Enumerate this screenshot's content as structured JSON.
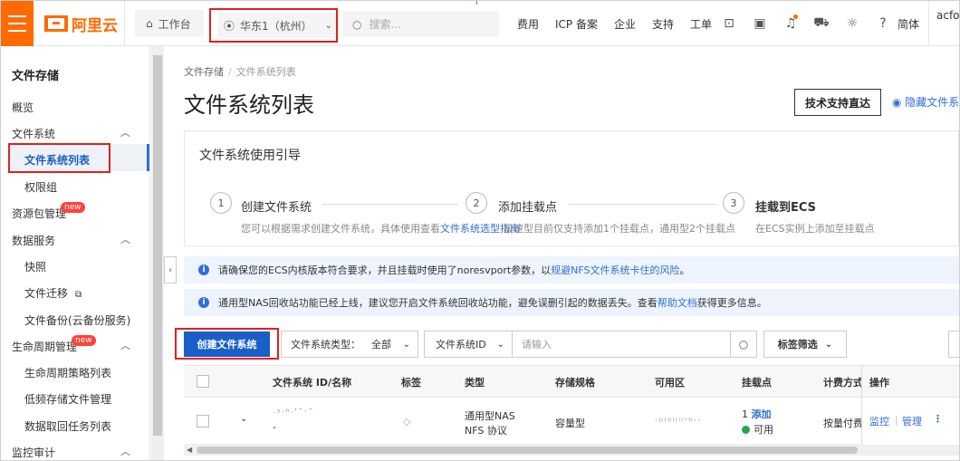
{
  "topbar": {
    "logo_text": "阿里云",
    "workbench_label": "工作台",
    "region_label": "华东1（杭州）",
    "search_placeholder": "搜索...",
    "nav": [
      "费用",
      "ICP 备案",
      "企业",
      "支持",
      "工单"
    ],
    "lang_label": "简体",
    "account_label": "acfor"
  },
  "sidebar": {
    "title": "文件存储",
    "items": {
      "overview": "概览",
      "fs_group": "文件系统",
      "fs_list": "文件系统列表",
      "perm_group": "权限组",
      "pkg_mgmt": "资源包管理",
      "data_service": "数据服务",
      "snapshot": "快照",
      "migration": "文件迁移",
      "backup": "文件备份(云备份服务)",
      "lifecycle": "生命周期管理",
      "lc_policy": "生命周期策略列表",
      "lowfreq": "低频存储文件管理",
      "retrieve": "数据取回任务列表",
      "audit": "监控审计"
    },
    "new_badge": "new"
  },
  "breadcrumb": {
    "root": "文件存储",
    "sep": "/",
    "current": "文件系统列表"
  },
  "page": {
    "title": "文件系统列表",
    "support_button": "技术支持直达",
    "hide_link": "隐藏文件系"
  },
  "guide": {
    "title": "文件系统使用引导",
    "steps": [
      {
        "num": "1",
        "title": "创建文件系统",
        "desc_before": "您可以根据需求创建文件系统，具体使用查看",
        "desc_link": "文件系统选型指南"
      },
      {
        "num": "2",
        "title": "添加挂载点",
        "desc": "极速型目前仅支持添加1个挂载点，通用型2个挂载点"
      },
      {
        "num": "3",
        "title": "挂载到ECS",
        "desc": "在ECS实例上添加至挂载点"
      }
    ]
  },
  "notices": [
    {
      "before": "请确保您的ECS内核版本符合要求，并且挂载时使用了noresvport参数，以",
      "link": "规避NFS文件系统卡住的风险",
      "after": "。"
    },
    {
      "before": "通用型NAS回收站功能已经上线，建议您开启文件系统回收站功能，避免误删引起的数据丢失。查看",
      "link": "帮助文档",
      "after": "获得更多信息。"
    }
  ],
  "toolbar": {
    "create_button": "创建文件系统",
    "type_label": "文件系统类型：",
    "type_value": "全部",
    "id_select": "文件系统ID",
    "id_placeholder": "请输入",
    "tag_filter": "标签筛选"
  },
  "table": {
    "headers": {
      "name": "文件系统 ID/名称",
      "tag": "标签",
      "type": "类型",
      "spec": "存储规格",
      "zone": "可用区",
      "mount": "挂载点",
      "billing": "计费方式",
      "ops": "操作"
    },
    "rows": [
      {
        "id": "·ˢˑʰᐧʼˉˑˉ",
        "name": "-",
        "type_line1": "通用型NAS",
        "type_line2": "NFS 协议",
        "spec": "容量型",
        "zone": "ˑᵖᶦʰˡ⁽ˡˡᵔʰˑˑ",
        "mount_count": "1",
        "mount_add": "添加",
        "mount_status": "可用",
        "billing": "按量付费",
        "op_monitor": "监控",
        "op_manage": "管理"
      }
    ]
  },
  "colors": {
    "accent": "#ff6a00",
    "primary": "#1a5fc7",
    "link": "#2f6fd6",
    "highlight": "#e02020"
  }
}
